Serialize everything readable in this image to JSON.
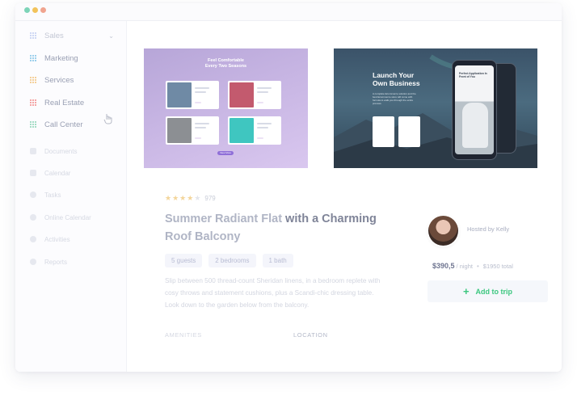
{
  "sidebar": {
    "items": [
      {
        "label": "Sales",
        "color": "#8fa7e6"
      },
      {
        "label": "Marketing",
        "color": "#7fc2e6"
      },
      {
        "label": "Services",
        "color": "#f2c27a"
      },
      {
        "label": "Real Estate",
        "color": "#f28b8b"
      },
      {
        "label": "Call Center",
        "color": "#8ad3b4"
      }
    ],
    "faded_items": [
      {
        "label": "Documents",
        "icon": "document-icon"
      },
      {
        "label": "Calendar",
        "icon": "calendar-icon"
      },
      {
        "label": "Tasks",
        "icon": "check-circle-icon"
      },
      {
        "label": "Online Calendar",
        "icon": "gear-icon"
      },
      {
        "label": "Activities",
        "icon": "clock-icon"
      },
      {
        "label": "Reports",
        "icon": "info-icon"
      }
    ]
  },
  "previews": {
    "left": {
      "heading_line1": "Feel Comfortable",
      "heading_line2": "Every Two Seasons",
      "button": "View More"
    },
    "right": {
      "heading_line1": "Launch Your",
      "heading_line2": "Own Business",
      "sub": "A complete Ecommerce solution and the best Ecommerce store will come with formula to walk you through the entire process.",
      "phone_title": "Perfect Application In Front of You"
    }
  },
  "listing": {
    "rating": 4,
    "rating_max": 5,
    "rating_count": "979",
    "title_light": "Summer Radiant Flat",
    "title_dark": " with a Charming",
    "title_light2": "Roof Balcony",
    "chips": [
      "5 guests",
      "2 bedrooms",
      "1 bath"
    ],
    "description": "Slip between 500 thread-count Sheridan linens, in a bedroom replete with cosy throws and statement cushions, plus a Scandi-chic dressing table. Look down to the garden below from the balcony.",
    "amenities_heading": "AMENITIES",
    "location_heading": "LOCATION"
  },
  "host": {
    "hosted_by": "Hosted by Kelly"
  },
  "booking": {
    "price": "$390,5",
    "price_unit": "/ night",
    "separator": "•",
    "total": "$1950 total",
    "add_button": "Add to trip",
    "accent": "#3cc77f"
  }
}
